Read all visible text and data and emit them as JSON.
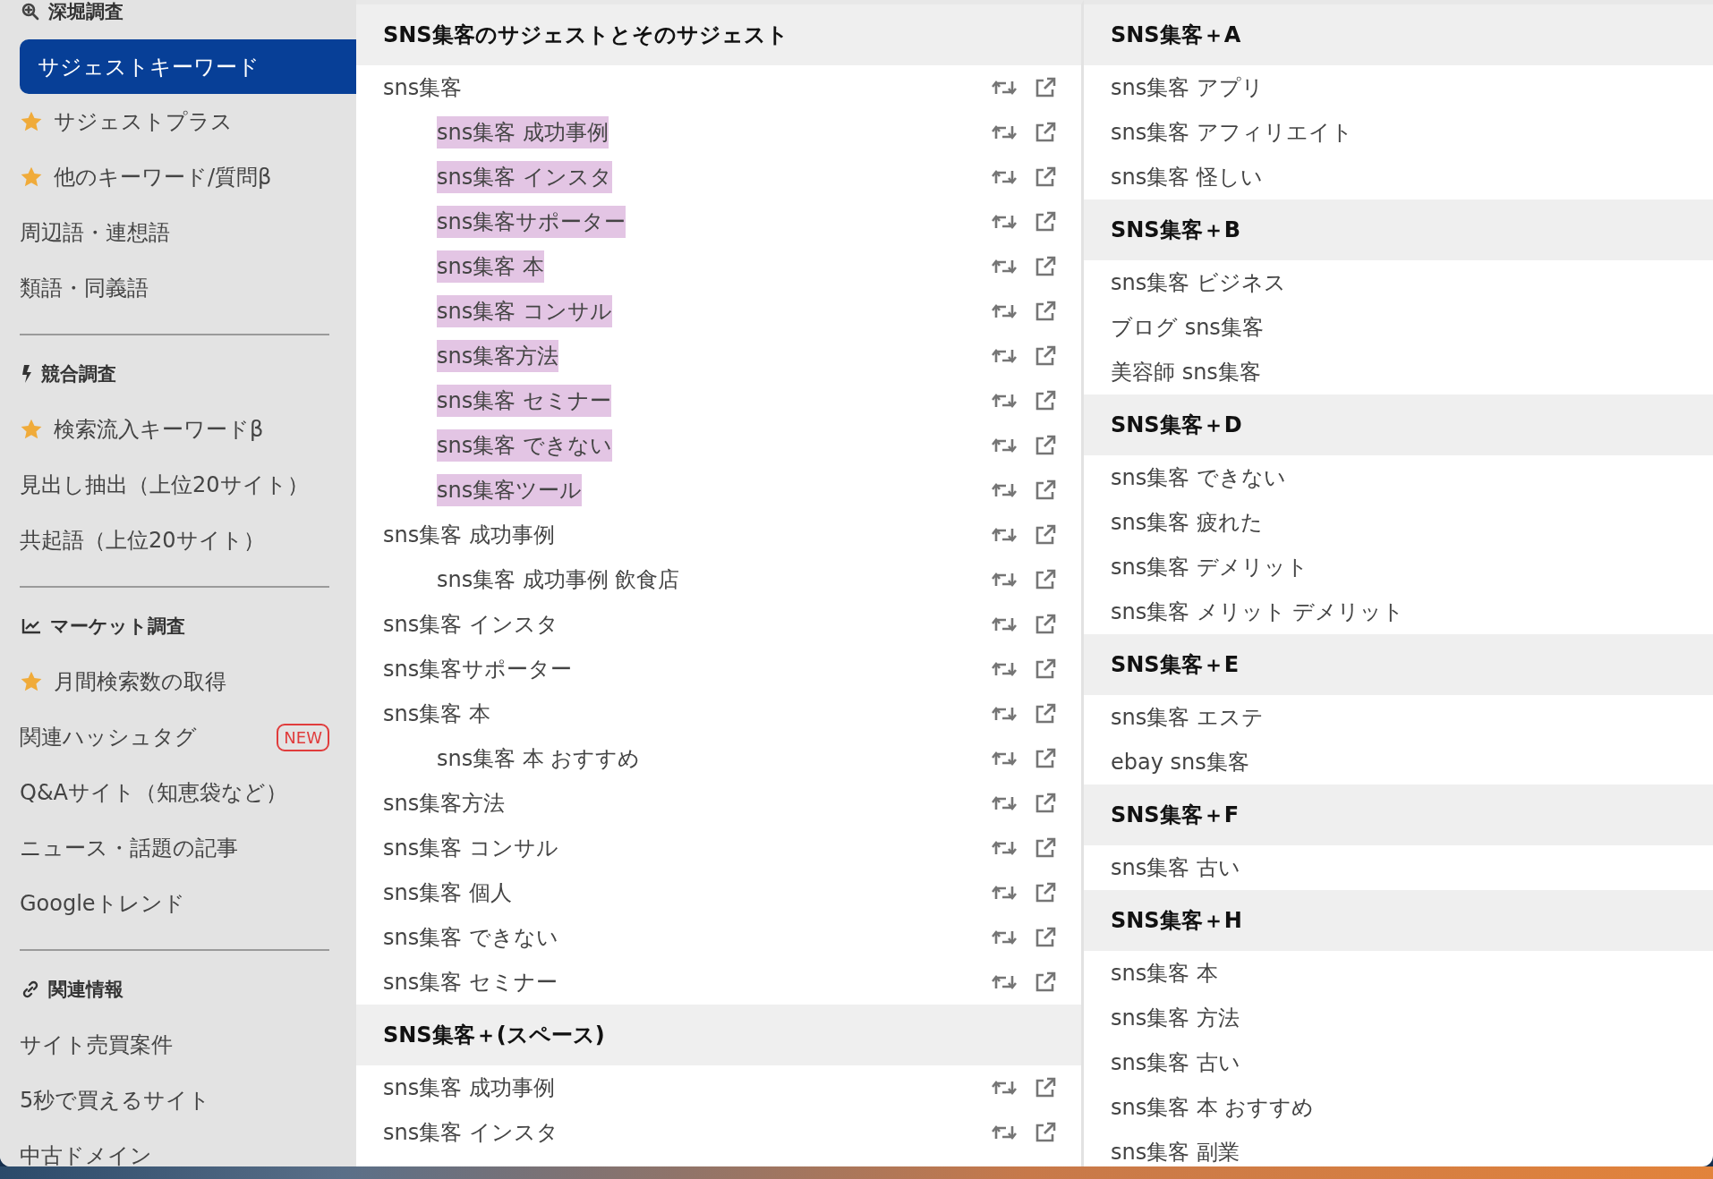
{
  "sidebar": {
    "sections": [
      {
        "kind": "search",
        "title": "深堀調査",
        "items": [
          {
            "label": "サジェストキーワード",
            "selected": true,
            "star": false
          },
          {
            "label": "サジェストプラス",
            "selected": false,
            "star": true
          },
          {
            "label": "他のキーワード/質問β",
            "selected": false,
            "star": true
          },
          {
            "label": "周辺語・連想語",
            "selected": false,
            "star": false
          },
          {
            "label": "類語・同義語",
            "selected": false,
            "star": false
          }
        ]
      },
      {
        "kind": "bolt",
        "title": "競合調査",
        "items": [
          {
            "label": "検索流入キーワードβ",
            "selected": false,
            "star": true
          },
          {
            "label": "見出し抽出（上位20サイト）",
            "selected": false,
            "star": false
          },
          {
            "label": "共起語（上位20サイト）",
            "selected": false,
            "star": false
          }
        ]
      },
      {
        "kind": "chart",
        "title": "マーケット調査",
        "items": [
          {
            "label": "月間検索数の取得",
            "selected": false,
            "star": true
          },
          {
            "label": "関連ハッシュタグ",
            "selected": false,
            "star": false,
            "badge": "NEW"
          },
          {
            "label": "Q&Aサイト（知恵袋など）",
            "selected": false,
            "star": false
          },
          {
            "label": "ニュース・話題の記事",
            "selected": false,
            "star": false
          },
          {
            "label": "Googleトレンド",
            "selected": false,
            "star": false
          }
        ]
      },
      {
        "kind": "link",
        "title": "関連情報",
        "items": [
          {
            "label": "サイト売買案件",
            "selected": false,
            "star": false
          },
          {
            "label": "5秒で買えるサイト",
            "selected": false,
            "star": false
          },
          {
            "label": "中古ドメイン",
            "selected": false,
            "star": false
          }
        ]
      }
    ]
  },
  "suggest_groups": [
    {
      "title": "SNS集客のサジェストとそのサジェスト",
      "rows": [
        {
          "text": "sns集客",
          "children": [
            {
              "text": "sns集客 成功事例",
              "highlighted": true
            },
            {
              "text": "sns集客 インスタ",
              "highlighted": true
            },
            {
              "text": "sns集客サポーター",
              "highlighted": true
            },
            {
              "text": "sns集客 本",
              "highlighted": true
            },
            {
              "text": "sns集客 コンサル",
              "highlighted": true
            },
            {
              "text": "sns集客方法",
              "highlighted": true
            },
            {
              "text": "sns集客 セミナー",
              "highlighted": true
            },
            {
              "text": "sns集客 できない",
              "highlighted": true
            },
            {
              "text": "sns集客ツール",
              "highlighted": true
            }
          ]
        },
        {
          "text": "sns集客 成功事例",
          "children": [
            {
              "text": "sns集客 成功事例 飲食店",
              "highlighted": false
            }
          ]
        },
        {
          "text": "sns集客 インスタ"
        },
        {
          "text": "sns集客サポーター"
        },
        {
          "text": "sns集客 本",
          "children": [
            {
              "text": "sns集客 本 おすすめ",
              "highlighted": false
            }
          ]
        },
        {
          "text": "sns集客方法"
        },
        {
          "text": "sns集客 コンサル"
        },
        {
          "text": "sns集客 個人"
        },
        {
          "text": "sns集客 できない"
        },
        {
          "text": "sns集客 セミナー"
        }
      ]
    },
    {
      "title": "SNS集客＋(スペース)",
      "rows": [
        {
          "text": "sns集客 成功事例"
        },
        {
          "text": "sns集客 インスタ"
        }
      ]
    }
  ],
  "plus_groups": [
    {
      "title": "SNS集客＋A",
      "items": [
        "sns集客 アプリ",
        "sns集客 アフィリエイト",
        "sns集客 怪しい"
      ]
    },
    {
      "title": "SNS集客＋B",
      "items": [
        "sns集客 ビジネス",
        "ブログ sns集客",
        "美容師 sns集客"
      ]
    },
    {
      "title": "SNS集客＋D",
      "items": [
        "sns集客 できない",
        "sns集客 疲れた",
        "sns集客 デメリット",
        "sns集客 メリット デメリット"
      ]
    },
    {
      "title": "SNS集客＋E",
      "items": [
        "sns集客 エステ",
        "ebay sns集客"
      ]
    },
    {
      "title": "SNS集客＋F",
      "items": [
        "sns集客 古い"
      ]
    },
    {
      "title": "SNS集客＋H",
      "items": [
        "sns集客 本",
        "sns集客 方法",
        "sns集客 古い",
        "sns集客 本 おすすめ",
        "sns集客 副業"
      ]
    }
  ]
}
